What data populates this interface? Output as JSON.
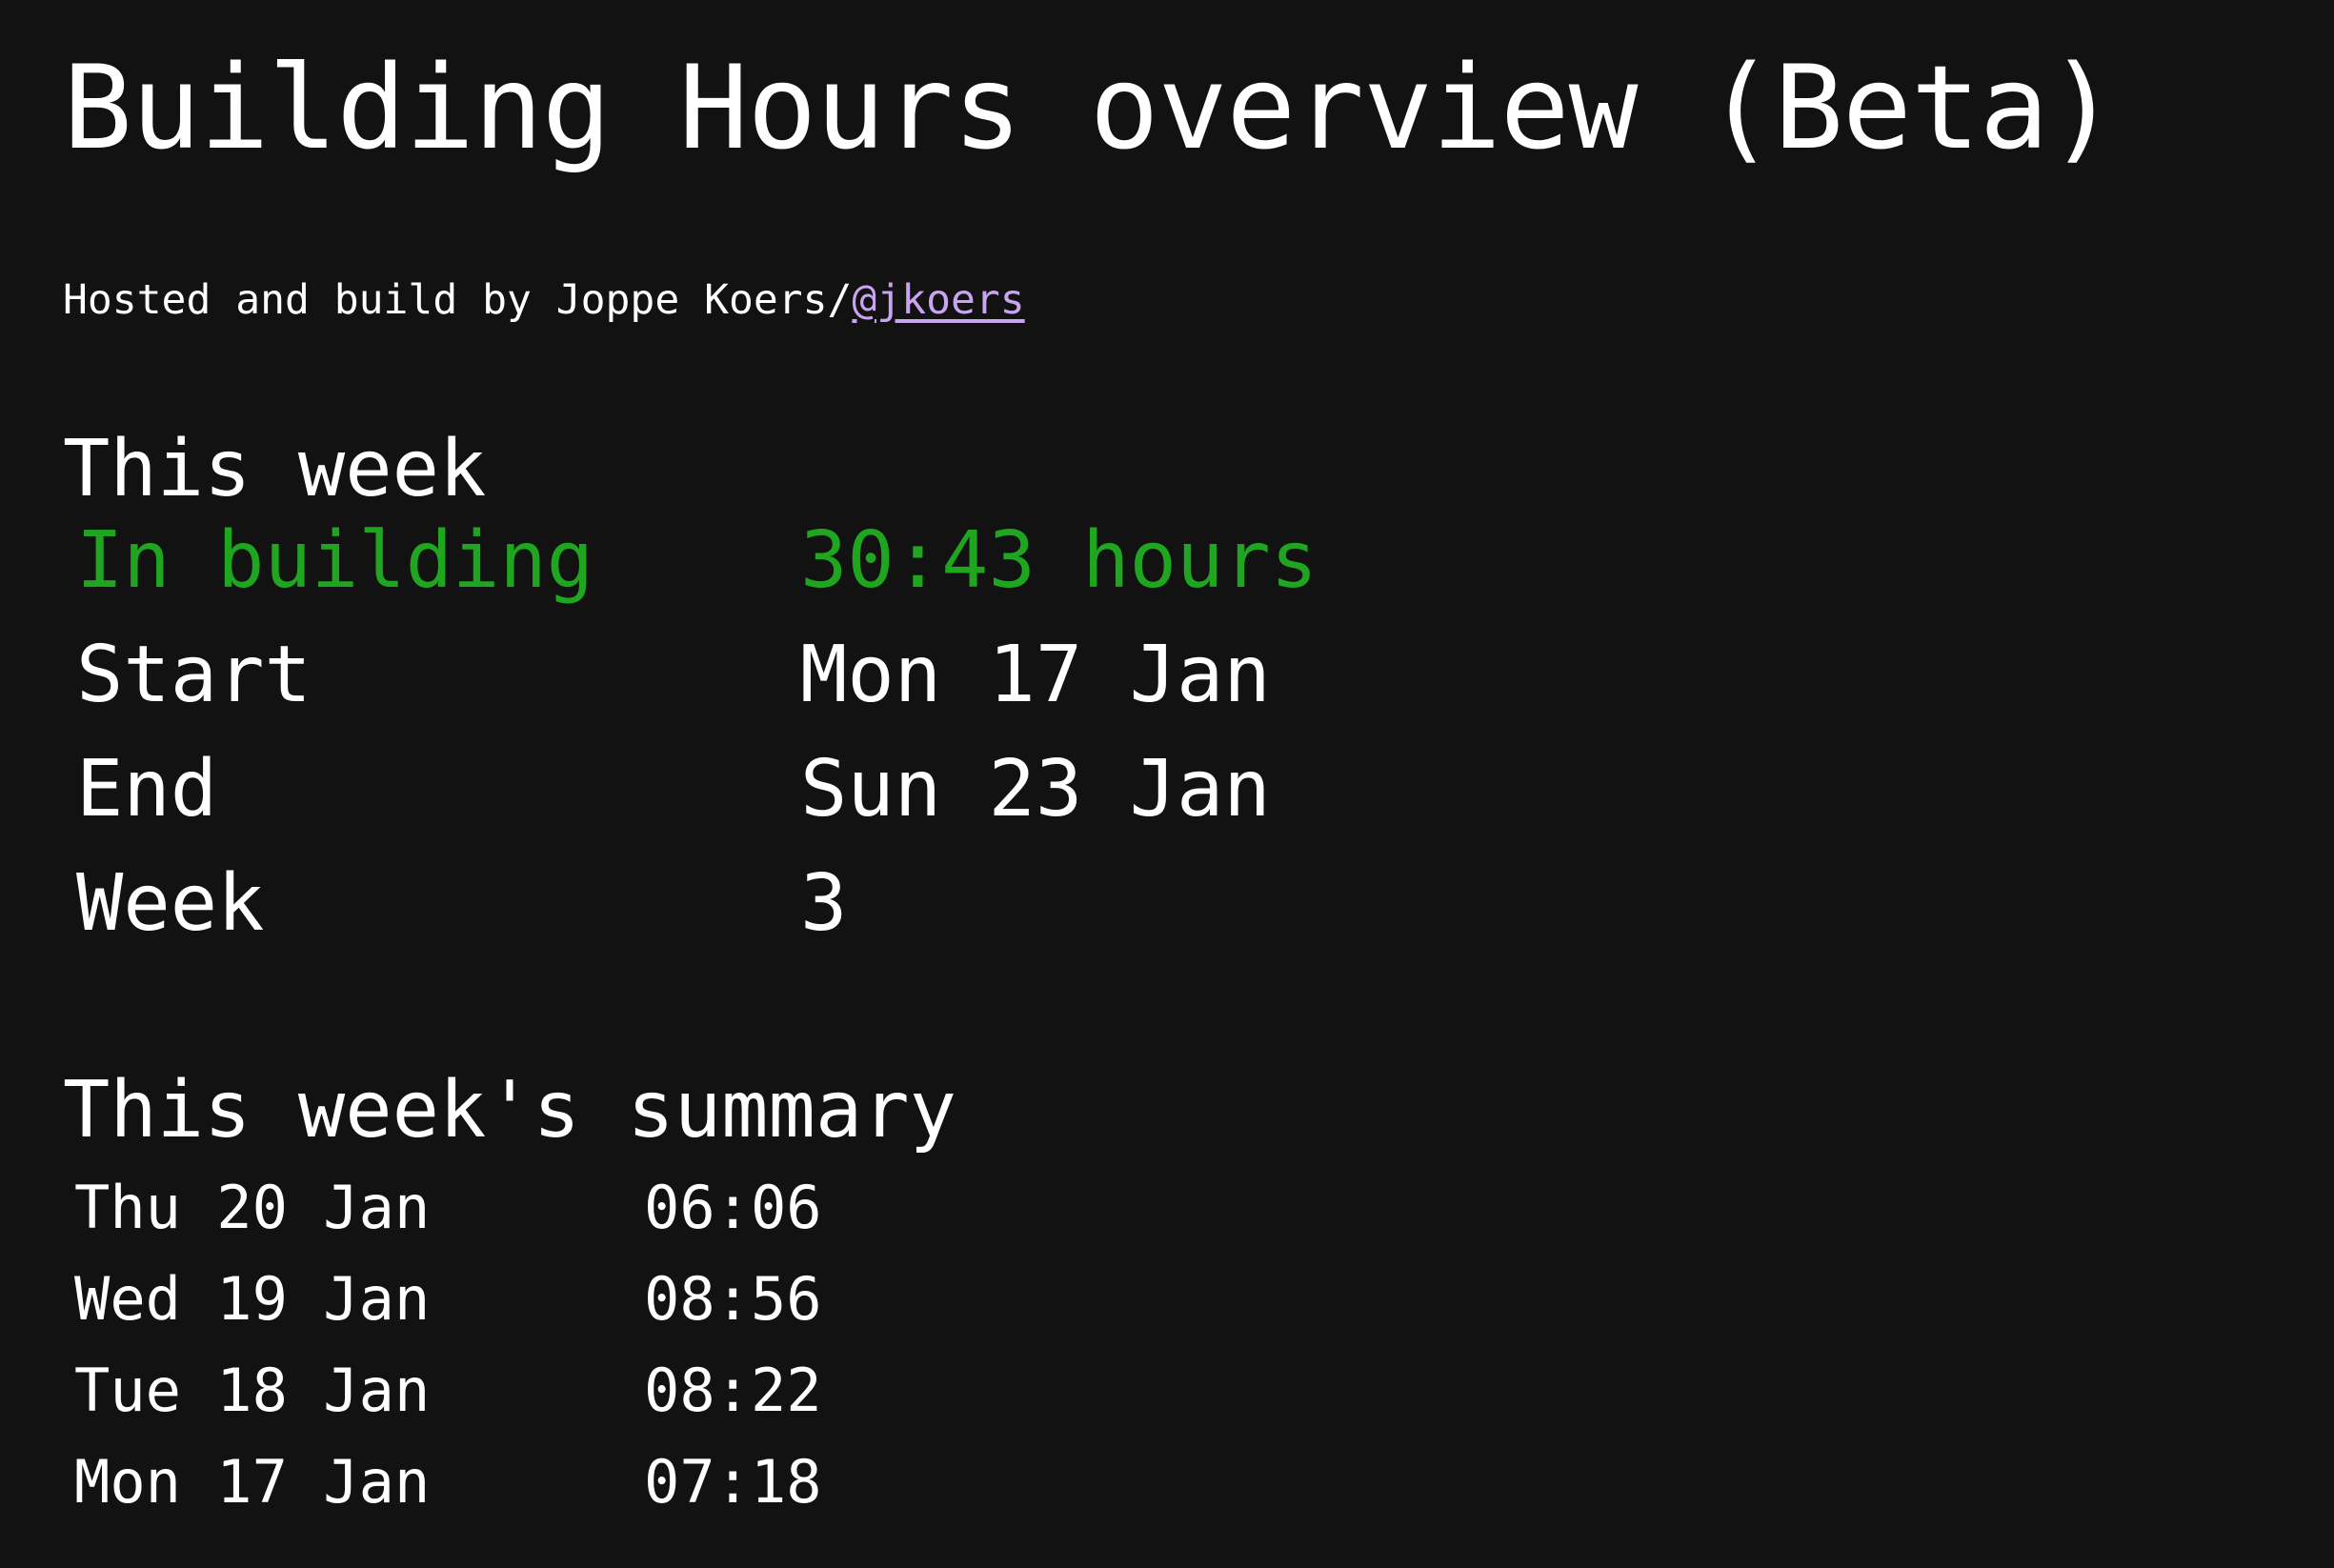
{
  "page": {
    "title": "Building Hours overview (Beta)",
    "credit_prefix": "Hosted and build by Joppe Koers/",
    "credit_link": "@jkoers"
  },
  "this_week": {
    "heading": "This week",
    "rows": [
      {
        "label": "In building",
        "value": "30:43 hours"
      },
      {
        "label": "Start",
        "value": "Mon 17 Jan"
      },
      {
        "label": "End",
        "value": "Sun 23 Jan"
      },
      {
        "label": "Week",
        "value": "3"
      }
    ]
  },
  "summary": {
    "heading": "This week's summary",
    "days": [
      {
        "day": "Thu 20 Jan",
        "hours": "06:06"
      },
      {
        "day": "Wed 19 Jan",
        "hours": "08:56"
      },
      {
        "day": "Tue 18 Jan",
        "hours": "08:22"
      },
      {
        "day": "Mon 17 Jan",
        "hours": "07:18"
      }
    ]
  },
  "colors": {
    "background": "#121212",
    "text": "#ffffff",
    "highlight": "#1fa51f",
    "link": "#c9a4f0"
  }
}
